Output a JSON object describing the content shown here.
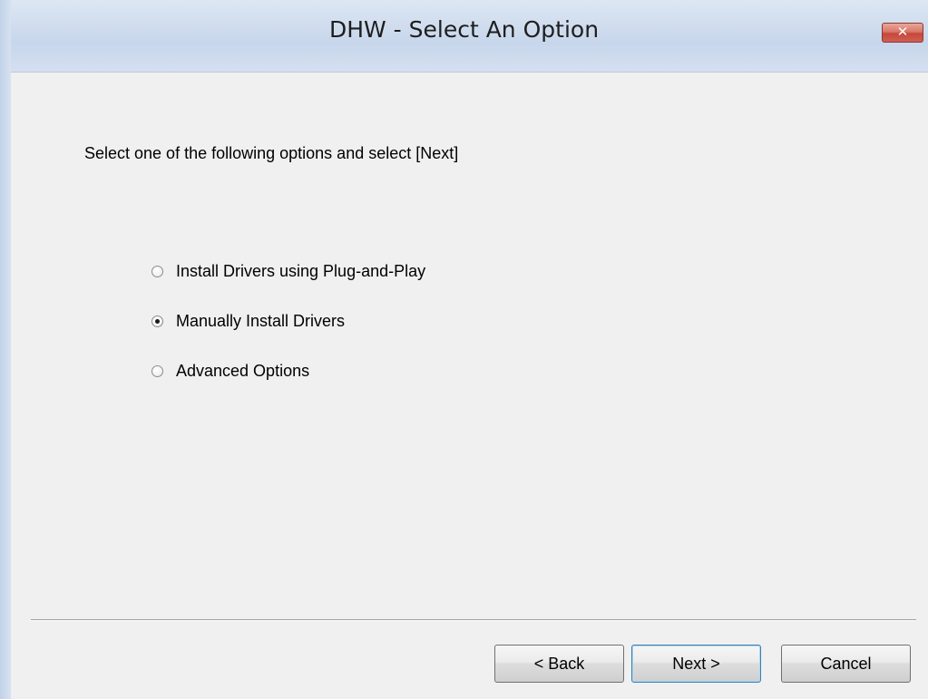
{
  "window": {
    "title": "DHW - Select An Option",
    "close_glyph": "✕"
  },
  "content": {
    "instruction": "Select one of the following options and select [Next]",
    "options": [
      {
        "label": "Install Drivers using Plug-and-Play",
        "selected": false
      },
      {
        "label": "Manually Install Drivers",
        "selected": true
      },
      {
        "label": "Advanced Options",
        "selected": false
      }
    ]
  },
  "buttons": {
    "back_label": "< Back",
    "next_label": "Next >",
    "cancel_label": "Cancel"
  },
  "colors": {
    "window_background": "#f0f0f0",
    "titlebar": "#cfdcee",
    "close_button": "#c7473a"
  }
}
